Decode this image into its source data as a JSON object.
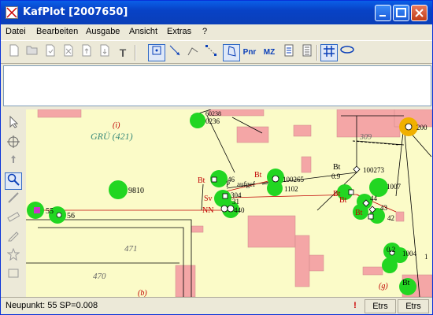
{
  "window": {
    "title": "KafPlot [2007650]"
  },
  "menu": {
    "items": [
      "Datei",
      "Bearbeiten",
      "Ausgabe",
      "Ansicht",
      "Extras",
      "?"
    ]
  },
  "toolbar": {
    "pnr_label": "Pnr",
    "mz_label": "MZ",
    "text_tool_label": "T"
  },
  "map": {
    "labels": {
      "flurstueck_i": "(i)",
      "gruen": "GRÜ (421)",
      "n_9810": "9810",
      "n_55": "55",
      "n_56": "56",
      "n_0236": "0236",
      "n_0238": "60238",
      "n_100265": "100265",
      "n_1102": "1102",
      "n_100273": "100273",
      "n_1007": "1007",
      "n_200": "200",
      "n_309": "309",
      "n_0_9": "0.9",
      "n_46": "46",
      "n_304": "304",
      "n_31": "31",
      "n_440": "440",
      "aufgef": "aufgef",
      "n_44": "44",
      "n_43": "43",
      "n_42": "42",
      "n_0_2": "0.2",
      "n_1004": "1004",
      "n_1": "1",
      "n_471": "471",
      "n_470": "470",
      "g_label": "(g)",
      "b_label": "(b)",
      "bt": "Bt",
      "sv": "Sv",
      "nn": "NN",
      "p": "P"
    },
    "colors": {
      "background": "#fbfbc8",
      "building": "#f4a6a6",
      "green_point": "#22d622",
      "red_line": "#c00000",
      "black_line": "#000000",
      "magenta": "#cc33cc",
      "orange": "#f0b000"
    }
  },
  "status": {
    "left_text": "Neupunkt: 55    SP=0.008",
    "alert_icon": "!",
    "pane1": "Etrs",
    "pane2": "Etrs"
  }
}
